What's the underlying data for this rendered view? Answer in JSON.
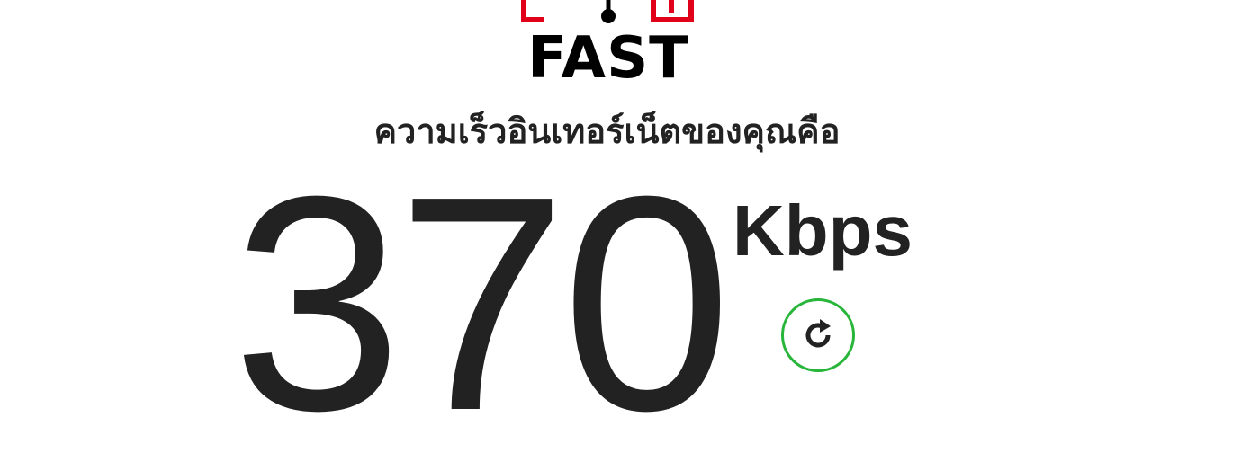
{
  "logo": {
    "text": "FAST",
    "mark_color": "#e1001a",
    "icon": "speedometer-logo-icon"
  },
  "headline": "ความเร็วอินเทอร์เน็ตของคุณคือ",
  "speed": {
    "value": "370",
    "units": "Kbps"
  },
  "refresh": {
    "icon": "refresh-icon",
    "border_color": "#27b53a"
  }
}
